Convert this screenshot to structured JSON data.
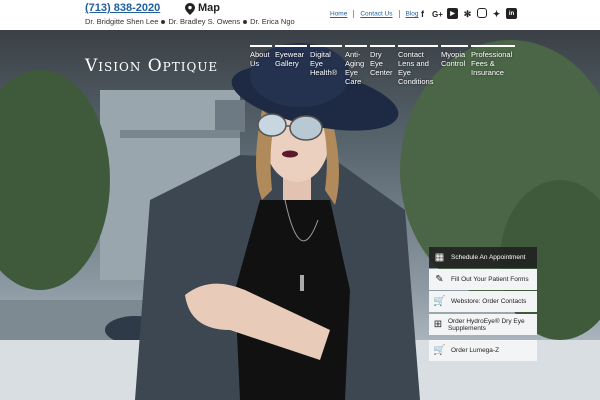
{
  "header": {
    "phone": "(713) 838-2020",
    "map_label": "Map",
    "doctors": [
      "Dr. Bridgitte Shen Lee",
      "Dr. Bradley S. Owens",
      "Dr. Erica Ngo"
    ],
    "util_links": [
      "Home",
      "Contact Us",
      "Blog"
    ],
    "social_icons": [
      "facebook-icon",
      "google-plus-icon",
      "youtube-icon",
      "yelp-icon",
      "instagram-icon",
      "twitter-icon",
      "linkedin-icon"
    ]
  },
  "brand": {
    "logo_text": "Vision Optique"
  },
  "nav": [
    {
      "lines": [
        "About",
        "Us"
      ]
    },
    {
      "lines": [
        "Eyewear",
        "Gallery"
      ]
    },
    {
      "lines": [
        "Digital",
        "Eye",
        "Health®"
      ]
    },
    {
      "lines": [
        "Anti-",
        "Aging",
        "Eye",
        "Care"
      ]
    },
    {
      "lines": [
        "Dry",
        "Eye",
        "Center"
      ]
    },
    {
      "lines": [
        "Contact",
        "Lens and",
        "Eye",
        "Conditions"
      ]
    },
    {
      "lines": [
        "Myopia",
        "Control"
      ]
    },
    {
      "lines": [
        "Professional",
        "Fees &",
        "Insurance"
      ]
    }
  ],
  "cta": [
    {
      "label": "Schedule An Appointment",
      "icon": "calendar-icon",
      "style": "dark"
    },
    {
      "label": "Fill Out Your Patient Forms",
      "icon": "pencil-icon",
      "style": "light"
    },
    {
      "label": "Webstore: Order Contacts",
      "icon": "cart-icon",
      "style": "light"
    },
    {
      "label": "Order HydroEye® Dry Eye Supplements",
      "icon": "basket-icon",
      "style": "light"
    },
    {
      "label": "Order Lumega-Z",
      "icon": "cart-icon",
      "style": "light"
    }
  ],
  "colors": {
    "link": "#1f5f9e",
    "cta_dark": "#202020",
    "cta_light": "#f3f4f5"
  }
}
